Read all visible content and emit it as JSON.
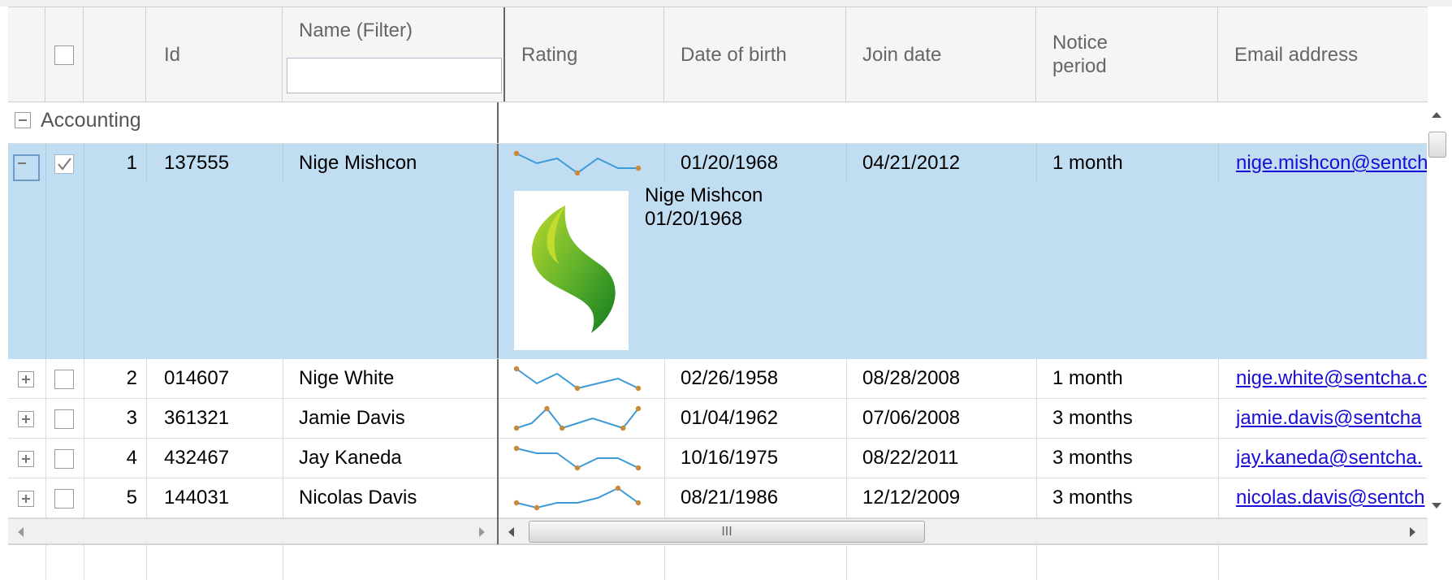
{
  "columns": {
    "select_all_checked": false,
    "id": "Id",
    "name_filter": "Name (Filter)",
    "name_filter_value": "",
    "rating": "Rating",
    "dob": "Date of birth",
    "join": "Join date",
    "notice_line1": "Notice",
    "notice_line2": "period",
    "email": "Email address"
  },
  "group": {
    "name": "Accounting"
  },
  "rows": [
    {
      "num": "1",
      "id": "137555",
      "name": "Nige Mishcon",
      "rating": [
        4,
        2,
        3,
        0,
        3,
        1,
        1
      ],
      "dob": "01/20/1968",
      "join": "04/21/2012",
      "notice": "1 month",
      "email": "nige.mishcon@sentch",
      "checked": true,
      "expanded": true
    },
    {
      "num": "2",
      "id": "014607",
      "name": "Nige White",
      "rating": [
        4,
        1,
        3,
        0,
        1,
        2,
        0
      ],
      "dob": "02/26/1958",
      "join": "08/28/2008",
      "notice": "1 month",
      "email": "nige.white@sentcha.c",
      "checked": false,
      "expanded": false
    },
    {
      "num": "3",
      "id": "361321",
      "name": "Jamie Davis",
      "rating": [
        0,
        1,
        4,
        0,
        1,
        2,
        1,
        0,
        4
      ],
      "dob": "01/04/1962",
      "join": "07/06/2008",
      "notice": "3 months",
      "email": "jamie.davis@sentcha",
      "checked": false,
      "expanded": false
    },
    {
      "num": "4",
      "id": "432467",
      "name": "Jay Kaneda",
      "rating": [
        4,
        3,
        3,
        0,
        2,
        2,
        0
      ],
      "dob": "10/16/1975",
      "join": "08/22/2011",
      "notice": "3 months",
      "email": "jay.kaneda@sentcha.",
      "checked": false,
      "expanded": false
    },
    {
      "num": "5",
      "id": "144031",
      "name": "Nicolas Davis",
      "rating": [
        1,
        0,
        1,
        1,
        2,
        4,
        1
      ],
      "dob": "08/21/1986",
      "join": "12/12/2009",
      "notice": "3 months",
      "email": "nicolas.davis@sentch",
      "checked": false,
      "expanded": false
    }
  ],
  "detail": {
    "name": "Nige Mishcon",
    "dob": "01/20/1968"
  },
  "colors": {
    "selected": "#c1ddf1",
    "sparkline": "#3d9ad6",
    "marker": "#c98a3a",
    "link": "#1a0dd8"
  },
  "scroll": {
    "thumb_glyph": "III"
  }
}
